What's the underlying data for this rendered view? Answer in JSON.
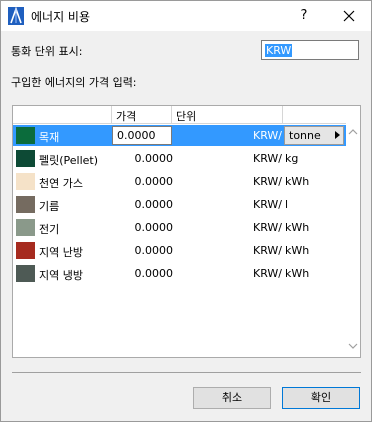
{
  "window": {
    "title": "에너지 비용",
    "help": "?",
    "icon": "archicad-icon",
    "close_icon": "close-icon"
  },
  "currency": {
    "label": "통화 단위 표시:",
    "value": "KRW"
  },
  "prompt": "구입한 에너지의 가격 입력:",
  "table": {
    "columns": [
      "가격",
      "단위"
    ],
    "rows": [
      {
        "name": "목재",
        "price": "0.0000",
        "currency": "KRW/",
        "unit": "tonne",
        "color": "#0b6c3c",
        "selected": true
      },
      {
        "name": "펠릿(Pellet)",
        "price": "0.0000",
        "currency": "KRW/",
        "unit": "kg",
        "color": "#0d4a35",
        "selected": false
      },
      {
        "name": "천연 가스",
        "price": "0.0000",
        "currency": "KRW/",
        "unit": "kWh",
        "color": "#f5e2c8",
        "selected": false
      },
      {
        "name": "기름",
        "price": "0.0000",
        "currency": "KRW/",
        "unit": "l",
        "color": "#756b60",
        "selected": false
      },
      {
        "name": "전기",
        "price": "0.0000",
        "currency": "KRW/",
        "unit": "kWh",
        "color": "#8a998a",
        "selected": false
      },
      {
        "name": "지역 난방",
        "price": "0.0000",
        "currency": "KRW/",
        "unit": "kWh",
        "color": "#a62b1f",
        "selected": false
      },
      {
        "name": "지역 냉방",
        "price": "0.0000",
        "currency": "KRW/",
        "unit": "kWh",
        "color": "#4e5a55",
        "selected": false
      }
    ]
  },
  "buttons": {
    "cancel": "취소",
    "ok": "확인"
  }
}
